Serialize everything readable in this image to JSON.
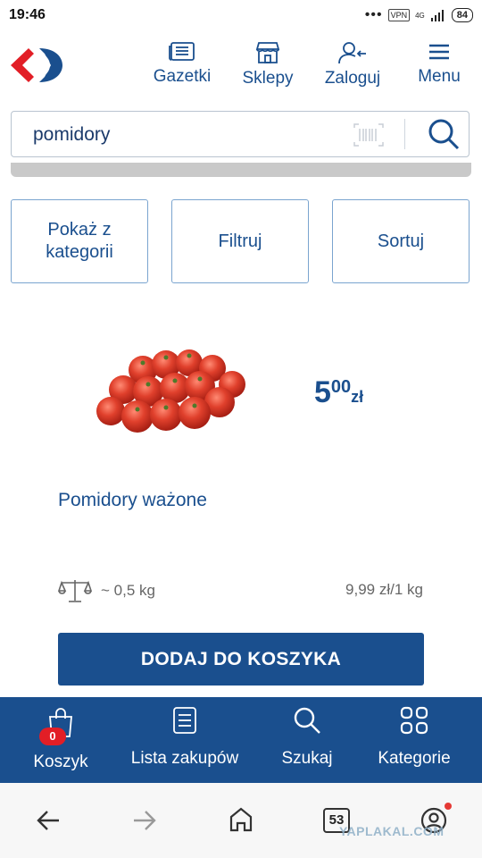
{
  "status_bar": {
    "time": "19:46",
    "vpn": "VPN",
    "network": "4G",
    "battery": "84"
  },
  "header": {
    "logo": "carrefour-logo",
    "nav": [
      {
        "label": "Gazetki",
        "icon": "newspaper-icon"
      },
      {
        "label": "Sklepy",
        "icon": "store-icon"
      },
      {
        "label": "Zaloguj",
        "icon": "user-login-icon"
      },
      {
        "label": "Menu",
        "icon": "hamburger-icon"
      }
    ]
  },
  "search": {
    "value": "pomidory",
    "barcode_icon": "barcode-icon",
    "search_icon": "search-icon"
  },
  "filters": [
    {
      "label": "Pokaż z kategorii"
    },
    {
      "label": "Filtruj"
    },
    {
      "label": "Sortuj"
    }
  ],
  "product": {
    "name": "Pomidory ważone",
    "price_int": "5",
    "price_dec": "00",
    "currency": "zł",
    "weight": "~ 0,5 kg",
    "unit_price": "9,99 zł/1 kg",
    "add_button": "DODAJ DO KOSZYKA"
  },
  "bottom_nav": {
    "cart_count": "0",
    "items": [
      {
        "label": "Koszyk",
        "icon": "shopping-bag-icon"
      },
      {
        "label": "Lista zakupów",
        "icon": "shopping-list-icon"
      },
      {
        "label": "Szukaj",
        "icon": "search-icon"
      },
      {
        "label": "Kategorie",
        "icon": "grid-icon"
      }
    ]
  },
  "browser_nav": {
    "tab_count": "53",
    "watermark": "YAPLAKAL.COM"
  },
  "colors": {
    "brand_blue": "#1a4f8e",
    "brand_red": "#e21e26",
    "border": "#7aa4cf"
  }
}
